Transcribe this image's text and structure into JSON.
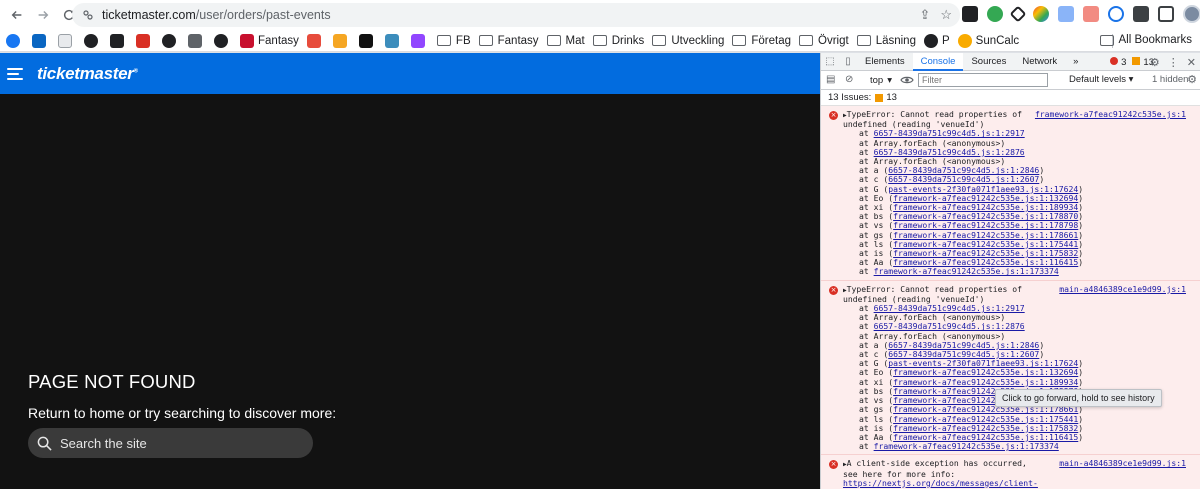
{
  "browser": {
    "url_domain": "ticketmaster.com",
    "url_path": "/user/orders/past-events",
    "bookmarks": [
      {
        "label": "",
        "color": "#1877f2"
      },
      {
        "label": "",
        "color": "#0a66c2"
      },
      {
        "label": "",
        "color": "#e8eaed"
      },
      {
        "label": "",
        "color": "#202124"
      },
      {
        "label": "",
        "color": "#202124"
      },
      {
        "label": "",
        "color": "#d93025"
      },
      {
        "label": "",
        "color": "#202124"
      },
      {
        "label": "",
        "color": "#5f6368"
      },
      {
        "label": "",
        "color": "#202124"
      },
      {
        "label": "Fantasy",
        "color": "#c8102e"
      },
      {
        "label": "",
        "color": "#e74c3c"
      },
      {
        "label": "",
        "color": "#f5a623"
      },
      {
        "label": "",
        "color": "#111111"
      },
      {
        "label": "",
        "color": "#3c8dbc"
      },
      {
        "label": "",
        "color": "#9146ff"
      }
    ],
    "folders": [
      "FB",
      "Fantasy",
      "Mat",
      "Drinks",
      "Utveckling",
      "Företag",
      "Övrigt",
      "Läsning"
    ],
    "extra_bookmarks": [
      "P",
      "SunCalc"
    ],
    "all_bookmarks": "All Bookmarks"
  },
  "page": {
    "logo": "ticketmaster",
    "title": "PAGE NOT FOUND",
    "subtitle": "Return to home or try searching to discover more:",
    "search_placeholder": "Search the site"
  },
  "devtools": {
    "tabs": [
      "Elements",
      "Console",
      "Sources",
      "Network"
    ],
    "active_tab": "Console",
    "error_count": "3",
    "warning_count": "13",
    "context": "top",
    "filter_placeholder": "Filter",
    "levels": "Default levels ▾",
    "hidden": "1 hidden",
    "issues_label": "13 Issues:",
    "issues_count": "13",
    "messages": [
      {
        "source": "framework-a7feac91242c535e.js:1",
        "head": "TypeError: Cannot read properties of undefined (reading 'venueId')",
        "frames": [
          {
            "pre": "at ",
            "fn": "",
            "link": "6657-8439da751c99c4d5.js:1:2917",
            "post": ""
          },
          {
            "pre": "at Array.forEach (<anonymous>)",
            "fn": "",
            "link": "",
            "post": ""
          },
          {
            "pre": "at ",
            "fn": "",
            "link": "6657-8439da751c99c4d5.js:1:2876",
            "post": ""
          },
          {
            "pre": "at Array.forEach (<anonymous>)",
            "fn": "",
            "link": "",
            "post": ""
          },
          {
            "pre": "at a (",
            "fn": "",
            "link": "6657-8439da751c99c4d5.js:1:2846",
            "post": ")"
          },
          {
            "pre": "at c (",
            "fn": "",
            "link": "6657-8439da751c99c4d5.js:1:2607",
            "post": ")"
          },
          {
            "pre": "at G (",
            "fn": "",
            "link": "past-events-2f30fa071f1aee93.js:1:17624",
            "post": ")"
          },
          {
            "pre": "at Eo (",
            "fn": "",
            "link": "framework-a7feac91242c535e.js:1:132694",
            "post": ")"
          },
          {
            "pre": "at xi (",
            "fn": "",
            "link": "framework-a7feac91242c535e.js:1:189934",
            "post": ")"
          },
          {
            "pre": "at bs (",
            "fn": "",
            "link": "framework-a7feac91242c535e.js:1:178870",
            "post": ")"
          },
          {
            "pre": "at vs (",
            "fn": "",
            "link": "framework-a7feac91242c535e.js:1:178798",
            "post": ")"
          },
          {
            "pre": "at gs (",
            "fn": "",
            "link": "framework-a7feac91242c535e.js:1:178661",
            "post": ")"
          },
          {
            "pre": "at ls (",
            "fn": "",
            "link": "framework-a7feac91242c535e.js:1:175441",
            "post": ")"
          },
          {
            "pre": "at is (",
            "fn": "",
            "link": "framework-a7feac91242c535e.js:1:175832",
            "post": ")"
          },
          {
            "pre": "at Aa (",
            "fn": "",
            "link": "framework-a7feac91242c535e.js:1:116415",
            "post": ")"
          },
          {
            "pre": "at ",
            "fn": "",
            "link": "framework-a7feac91242c535e.js:1:173374",
            "post": ""
          }
        ]
      },
      {
        "source": "main-a4846389ce1e9d99.js:1",
        "head": "TypeError: Cannot read properties of undefined (reading 'venueId')",
        "frames": [
          {
            "pre": "at ",
            "fn": "",
            "link": "6657-8439da751c99c4d5.js:1:2917",
            "post": ""
          },
          {
            "pre": "at Array.forEach (<anonymous>)",
            "fn": "",
            "link": "",
            "post": ""
          },
          {
            "pre": "at ",
            "fn": "",
            "link": "6657-8439da751c99c4d5.js:1:2876",
            "post": ""
          },
          {
            "pre": "at Array.forEach (<anonymous>)",
            "fn": "",
            "link": "",
            "post": ""
          },
          {
            "pre": "at a (",
            "fn": "",
            "link": "6657-8439da751c99c4d5.js:1:2846",
            "post": ")"
          },
          {
            "pre": "at c (",
            "fn": "",
            "link": "6657-8439da751c99c4d5.js:1:2607",
            "post": ")"
          },
          {
            "pre": "at G (",
            "fn": "",
            "link": "past-events-2f30fa071f1aee93.js:1:17624",
            "post": ")"
          },
          {
            "pre": "at Eo (",
            "fn": "",
            "link": "framework-a7feac91242c535e.js:1:132694",
            "post": ")"
          },
          {
            "pre": "at xi (",
            "fn": "",
            "link": "framework-a7feac91242c535e.js:1:189934",
            "post": ")"
          },
          {
            "pre": "at bs (",
            "fn": "",
            "link": "framework-a7feac91242c535e.js:1:178870",
            "post": ")"
          },
          {
            "pre": "at vs (",
            "fn": "",
            "link": "framework-a7feac91242c535e.js:1:178798",
            "post": ")"
          },
          {
            "pre": "at gs (",
            "fn": "",
            "link": "framework-a7feac91242c535e.js:1:178661",
            "post": ")"
          },
          {
            "pre": "at ls (",
            "fn": "",
            "link": "framework-a7feac91242c535e.js:1:175441",
            "post": ")"
          },
          {
            "pre": "at is (",
            "fn": "",
            "link": "framework-a7feac91242c535e.js:1:175832",
            "post": ")"
          },
          {
            "pre": "at Aa (",
            "fn": "",
            "link": "framework-a7feac91242c535e.js:1:116415",
            "post": ")"
          },
          {
            "pre": "at ",
            "fn": "",
            "link": "framework-a7feac91242c535e.js:1:173374",
            "post": ""
          }
        ]
      }
    ],
    "client_exception": {
      "source": "main-a4846389ce1e9d99.js:1",
      "text": "A client-side exception has occurred, see here for more info: ",
      "link": "https://nextjs.org/docs/messages/client-side-exception-occurred"
    },
    "tooltip": "Click to go forward, hold to see history"
  }
}
